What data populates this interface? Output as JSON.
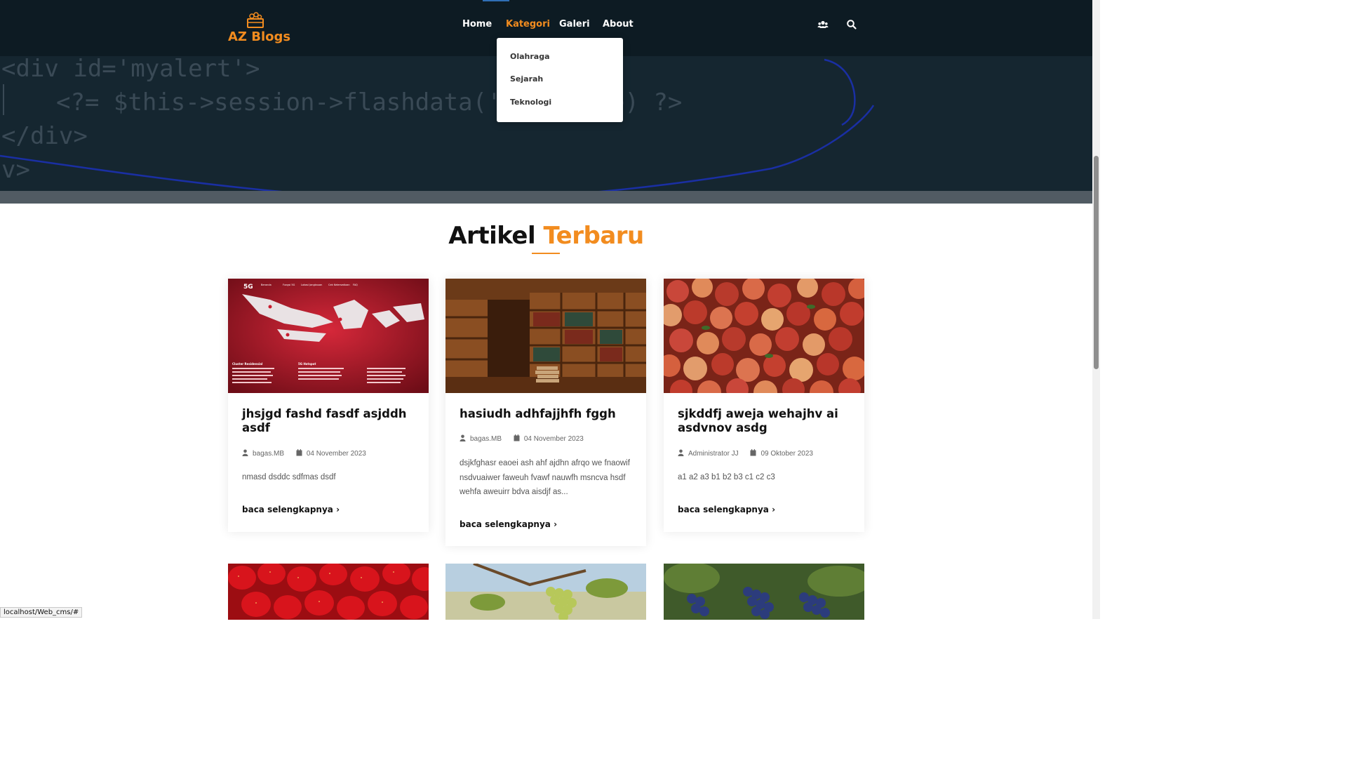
{
  "brand": {
    "name": "AZ Blogs",
    "accent": "#f28c1f"
  },
  "nav": {
    "items": [
      "Home",
      "Kategori",
      "Galeri",
      "About"
    ],
    "active": "Kategori",
    "icons": [
      "users-icon",
      "search-icon"
    ]
  },
  "dropdown": {
    "items": [
      "Olahraga",
      "Sejarah",
      "Teknologi"
    ]
  },
  "hero_code": {
    "line1": "<div id='myalert'>",
    "line2": "<?= $this->session->flashdata('al",
    "line2b": "e) ?>",
    "line3": "</div>",
    "line4": "v>"
  },
  "section": {
    "title_main": "Artikel",
    "title_accent": "Terbaru"
  },
  "articles": [
    {
      "title": "jhsjgd fashd fasdf asjddh asdf",
      "author": "bagas.MB",
      "date": "04 November 2023",
      "excerpt": "nmasd dsddc sdfmas dsdf",
      "read_more": "baca selengkapnya"
    },
    {
      "title": "hasiudh adhfajjhfh fggh",
      "author": "bagas.MB",
      "date": "04 November 2023",
      "excerpt": "dsjkfghasr eaoei ash ahf ajdhn afrqo we fnaowif nsdvuaiwer faweuh fvawf nauwfh msncva hsdf wehfa aweuirr bdva aisdjf as...",
      "read_more": "baca selengkapnya"
    },
    {
      "title": "sjkddfj aweja wehajhv ai asdvnov asdg",
      "author": "Administrator JJ",
      "date": "09 Oktober 2023",
      "excerpt": "a1 a2 a3 b1 b2 b3 c1 c2 c3",
      "read_more": "baca selengkapnya"
    }
  ],
  "thumb_5g": {
    "logo": "5G",
    "menu": [
      "Beranda",
      "Fungsi 5G",
      "Lokasi Jangkauan",
      "Cek Ketersediaan",
      "FAQ"
    ],
    "columns": [
      "Cluster Residensial",
      "5G Hotspot"
    ]
  },
  "status_url": "localhost/Web_cms/#"
}
